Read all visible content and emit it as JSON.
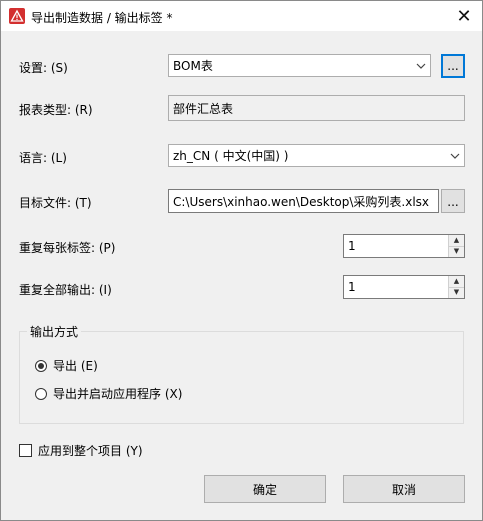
{
  "window": {
    "title": "导出制造数据 / 输出标签 *",
    "close_glyph": "✕"
  },
  "form": {
    "settings": {
      "label": "设置: (S)",
      "value": "BOM表",
      "browse_label": "..."
    },
    "report_type": {
      "label": "报表类型: (R)",
      "value": "部件汇总表"
    },
    "language": {
      "label": "语言: (L)",
      "value": "zh_CN ( 中文(中国) )"
    },
    "target_file": {
      "label": "目标文件: (T)",
      "value": "C:\\Users\\xinhao.wen\\Desktop\\采购列表.xlsx",
      "browse_label": "..."
    },
    "repeat_each_label": {
      "label": "重复每张标签: (P)",
      "value": "1"
    },
    "repeat_all_output": {
      "label": "重复全部输出: (I)",
      "value": "1"
    }
  },
  "output_mode": {
    "title": "输出方式",
    "options": [
      {
        "label": "导出 (E)",
        "checked": true
      },
      {
        "label": "导出并启动应用程序 (X)",
        "checked": false
      }
    ]
  },
  "apply_to_project": {
    "label": "应用到整个项目 (Y)",
    "checked": false
  },
  "buttons": {
    "ok": "确定",
    "cancel": "取消"
  },
  "icons": {
    "app": "warning-triangle-icon",
    "dropdown": "chevron-down-icon",
    "spin_up": "spin-up-icon",
    "spin_down": "spin-down-icon"
  },
  "colors": {
    "app_icon_red": "#d32f2f",
    "focus_blue": "#0078d7"
  }
}
